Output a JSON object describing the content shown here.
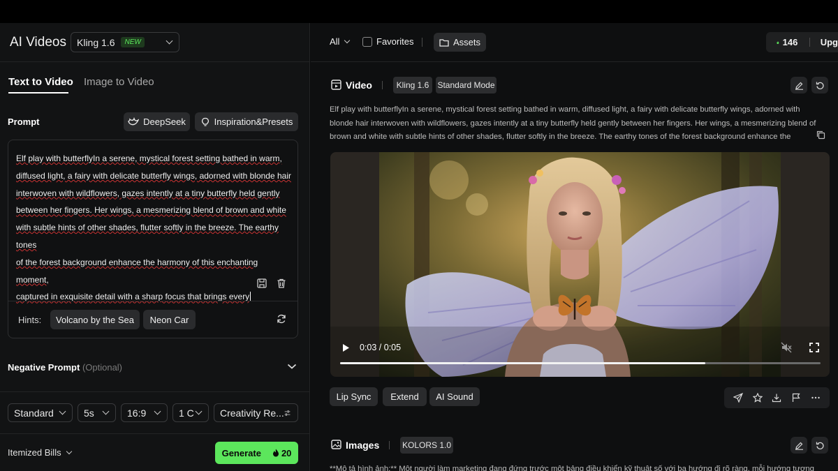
{
  "app": {
    "title": "AI Videos"
  },
  "model_select": {
    "value": "Kling 1.6",
    "badge": "NEW"
  },
  "tabs": [
    {
      "label": "Text to Video"
    },
    {
      "label": "Image to Video"
    }
  ],
  "prompt": {
    "label": "Prompt",
    "deepseek_label": "DeepSeek",
    "presets_label": "Inspiration&Presets",
    "text": "Elf play with butterflyIn a serene, mystical forest setting bathed in warm, diffused light, a fairy with delicate butterfly wings, adorned with blonde hair interwoven with wildflowers, gazes intently at a tiny butterfly held gently between her fingers. Her wings, a mesmerizing blend of brown and white with subtle hints of other shades, flutter softly in the breeze. The earthy tones of the forest background enhance the harmony of this enchanting moment, captured in exquisite detail with a sharp focus that brings every",
    "lines": [
      "Elf play with butterflyIn a serene, mystical forest setting bathed in warm,",
      "diffused light, a fairy with delicate butterfly wings, adorned with blonde hair",
      "interwoven with wildflowers, gazes intently at a tiny butterfly held gently",
      "between her fingers. Her wings, a mesmerizing blend of brown and white",
      "with subtle hints of other shades, flutter softly in the breeze. The earthy tones",
      "of the forest background enhance the harmony of this enchanting moment,",
      "captured in exquisite detail with a sharp focus that brings every"
    ]
  },
  "hints": {
    "label": "Hints:",
    "items": [
      "Volcano by the Sea",
      "Neon Car"
    ]
  },
  "negative_prompt": {
    "label": "Negative Prompt",
    "optional": "(Optional)"
  },
  "settings": {
    "mode": "Standard",
    "duration": "5s",
    "ratio": "16:9",
    "count": "1 C",
    "creativity": "Creativity Re..."
  },
  "footer": {
    "bills_label": "Itemized Bills",
    "generate_label": "Generate",
    "generate_cost": "20"
  },
  "filter": {
    "all_label": "All",
    "favorites_label": "Favorites",
    "assets_label": "Assets"
  },
  "credits": {
    "count": "146",
    "upgrade_label": "Upg"
  },
  "video_card": {
    "title": "Video",
    "model_tag": "Kling 1.6",
    "mode_tag": "Standard Mode",
    "prompt_lines": [
      "Elf play with butterflyIn a serene, mystical forest setting bathed in warm, diffused light, a fairy with delicate butterfly wings, adorned with",
      "blonde hair interwoven with wildflowers, gazes intently at a tiny butterfly held gently between her fingers. Her wings, a mesmerizing blend of",
      "brown and white with subtle hints of other shades, flutter softly in the breeze. The earthy tones of the forest background enhance the"
    ],
    "time": "0:03 / 0:05",
    "progress": 0.76,
    "actions": [
      "Lip Sync",
      "Extend",
      "AI Sound"
    ]
  },
  "images_card": {
    "title": "Images",
    "model_tag": "KOLORS 1.0",
    "prompt_preview": "**Mô tả hình ảnh:** Một người làm marketing đang đứng trước một bảng điều khiển kỹ thuật số với ba hướng đi rõ ràng, mỗi hướng tượng"
  },
  "colors": {
    "accent": "#5ce65c",
    "background": "#0e0f10",
    "panel": "#121314"
  }
}
